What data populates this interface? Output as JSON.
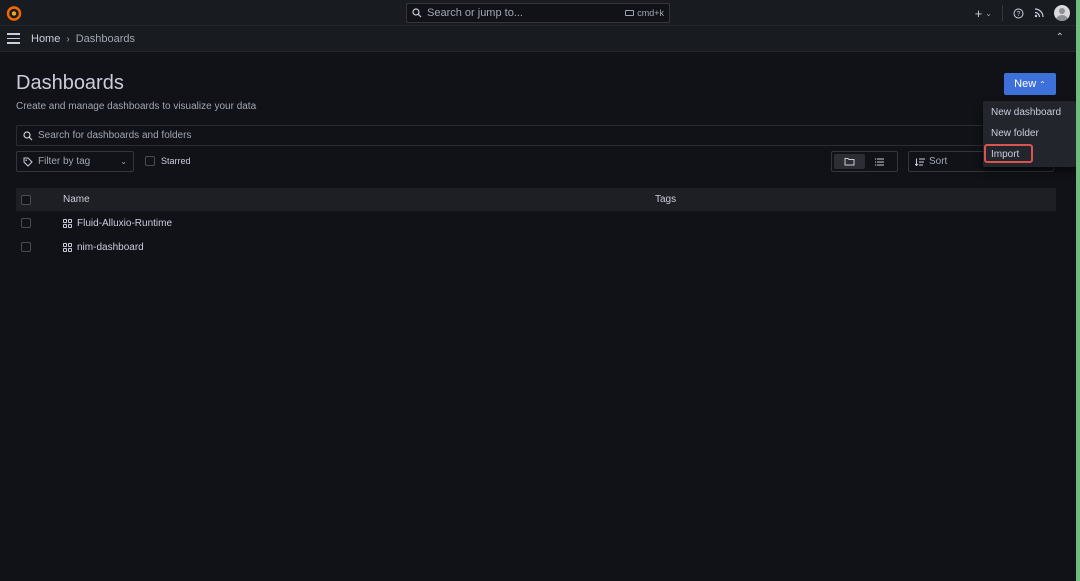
{
  "topbar": {
    "search_placeholder": "Search or jump to...",
    "shortcut": "cmd+k",
    "add_label": "+"
  },
  "breadcrumb": {
    "home": "Home",
    "separator": "›",
    "current": "Dashboards"
  },
  "page": {
    "title": "Dashboards",
    "subtitle": "Create and manage dashboards to visualize your data",
    "new_button": "New"
  },
  "search": {
    "placeholder": "Search for dashboards and folders"
  },
  "filters": {
    "tag_placeholder": "Filter by tag",
    "starred_label": "Starred",
    "sort_placeholder": "Sort"
  },
  "table": {
    "headers": {
      "name": "Name",
      "tags": "Tags"
    },
    "rows": [
      {
        "name": "Fluid-Alluxio-Runtime",
        "tags": ""
      },
      {
        "name": "nim-dashboard",
        "tags": ""
      }
    ]
  },
  "new_menu": {
    "items": [
      {
        "label": "New dashboard"
      },
      {
        "label": "New folder"
      },
      {
        "label": "Import"
      }
    ]
  },
  "colors": {
    "background": "#111217",
    "panel": "#181b1f",
    "primary": "#3d71d9",
    "highlight": "#d9534f",
    "edge_accent": "#6cc07b"
  }
}
